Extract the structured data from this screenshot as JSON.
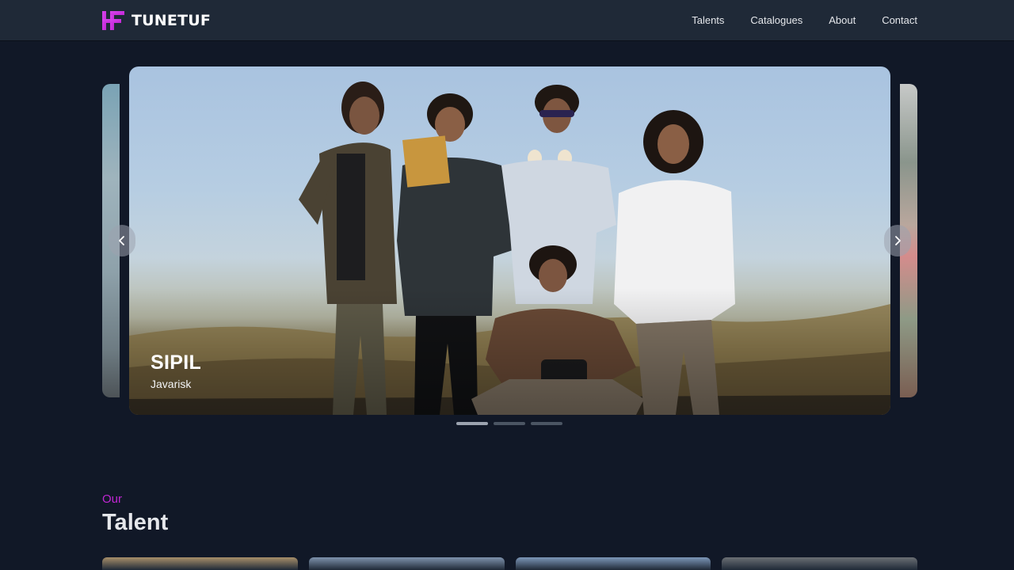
{
  "header": {
    "brand_name": "TUNETUF",
    "logo_icon": "tunetuf-logo-icon",
    "nav": [
      {
        "label": "Talents"
      },
      {
        "label": "Catalogues"
      },
      {
        "label": "About"
      },
      {
        "label": "Contact"
      }
    ]
  },
  "carousel": {
    "current_slide": {
      "title": "SIPIL",
      "subtitle": "Javarisk"
    },
    "prev_icon": "chevron-left-icon",
    "next_icon": "chevron-right-icon",
    "slide_count": 3,
    "active_index": 0
  },
  "talent_section": {
    "eyebrow": "Our",
    "title": "Talent",
    "cards": [
      {
        "color": "#a88f6a"
      },
      {
        "color": "#7f93ad"
      },
      {
        "color": "#7d97b8"
      },
      {
        "color": "#6b6f74"
      }
    ]
  },
  "colors": {
    "background": "#111827",
    "navbar": "#1f2937",
    "accent": "#c026d3"
  }
}
